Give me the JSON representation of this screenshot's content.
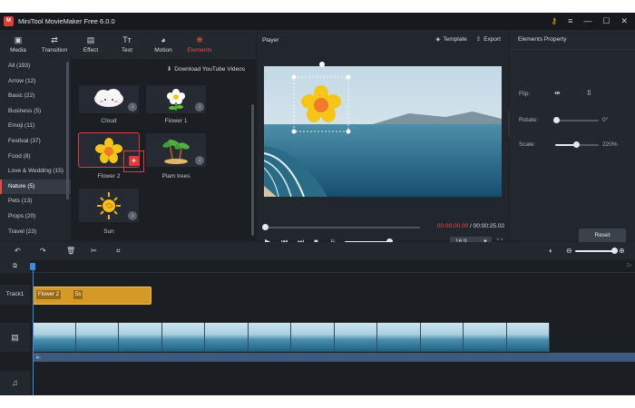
{
  "window": {
    "title": "MiniTool MovieMaker Free 6.0.0",
    "logo_text": "M",
    "controls": [
      "key-icon",
      "menu-icon",
      "minimize-icon",
      "maximize-icon",
      "close-icon"
    ]
  },
  "toolbar": {
    "tabs": [
      {
        "label": "Media",
        "icon": "media-icon"
      },
      {
        "label": "Transition",
        "icon": "transition-icon"
      },
      {
        "label": "Effect",
        "icon": "effect-icon"
      },
      {
        "label": "Text",
        "icon": "text-icon"
      },
      {
        "label": "Motion",
        "icon": "motion-icon"
      },
      {
        "label": "Elements",
        "icon": "elements-icon",
        "active": true
      }
    ]
  },
  "categories": [
    "All (193)",
    "Arrow (12)",
    "Basic (22)",
    "Business (5)",
    "Emoji (11)",
    "Festival (37)",
    "Food (8)",
    "Love & Wedding (15)",
    "Nature (5)",
    "Pets (13)",
    "Props (20)",
    "Travel (23)"
  ],
  "categories_active_index": 8,
  "elements": {
    "download_youtube": "Download YouTube Videos",
    "items": [
      "Cloud",
      "Flower 1",
      "Flower 2",
      "Plam trees",
      "Sun"
    ]
  },
  "player": {
    "title": "Player",
    "template_label": "Template",
    "export_label": "Export",
    "time_current": "00:00:00.00",
    "time_separator": " / ",
    "time_total": "00:00:25.02",
    "aspect_ratio": "16:9",
    "progress": 0.0
  },
  "properties": {
    "title": "Elements Property",
    "flip_label": "Flip:",
    "rotate_label": "Rotate:",
    "rotate_value": "0°",
    "rotate_fraction": 0.0,
    "scale_label": "Scale:",
    "scale_value": "220%",
    "scale_fraction": 0.5,
    "reset_label": "Reset"
  },
  "timeline": {
    "track1_label": "Track1",
    "clip_name": "Flower 2",
    "clip_duration": "5s",
    "video_frames": 12
  },
  "colors": {
    "accent": "#e23a3a",
    "clip": "#d49a25",
    "playhead": "#3b8be0",
    "bg": "#1e2329"
  }
}
